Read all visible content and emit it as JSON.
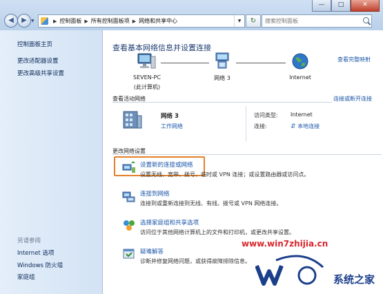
{
  "window": {
    "minimize_glyph": "—",
    "maximize_glyph": "□",
    "close_glyph": "✕"
  },
  "nav": {
    "back_glyph": "◀",
    "forward_glyph": "▶",
    "refresh_glyph": "↻"
  },
  "address": {
    "crumbs": [
      "控制面板",
      "所有控制面板项",
      "网络和共享中心"
    ]
  },
  "search": {
    "placeholder": "搜索控制面板"
  },
  "sidebar": {
    "home": "控制面板主页",
    "adapter": "更改适配器设置",
    "advanced": "更改高级共享设置",
    "see_also": "另请参阅",
    "ie_options": "Internet 选项",
    "firewall": "Windows 防火墙",
    "homegroup": "家庭组"
  },
  "main": {
    "title": "查看基本网络信息并设置连接",
    "full_map": "查看完整映射",
    "map": {
      "computer_name": "SEVEN-PC",
      "computer_sub": "(此计算机)",
      "network": "网络  3",
      "internet": "Internet"
    },
    "active": {
      "header": "查看活动网络",
      "connect_link": "连接或断开连接",
      "network_name": "网络  3",
      "network_type": "工作网络",
      "access_label": "访问类型:",
      "access_value": "Internet",
      "conn_label": "连接:",
      "conn_value": "本地连接"
    },
    "change": {
      "header": "更改网络设置",
      "tasks": [
        {
          "link": "设置新的连接或网络",
          "desc": "设置无线、宽带、拨号、临时或 VPN 连接；或设置路由器或访问点。"
        },
        {
          "link": "连接到网络",
          "desc": "连接到或重新连接到无线、有线、拨号或 VPN 网络连接。"
        },
        {
          "link": "选择家庭组和共享选项",
          "desc": "访问位于其他网络计算机上的文件和打印机，或更改共享设置。"
        },
        {
          "link": "疑难解答",
          "desc": "诊断并修复网络问题，或获得故障排除信息。"
        }
      ]
    }
  },
  "watermark": {
    "url": "www.win7zhijia.cn",
    "brand": "系统之家"
  },
  "colors": {
    "link": "#1b56a8",
    "title": "#1c3b72",
    "highlight": "#e57f27",
    "sidebar": "#dbe8f6"
  }
}
